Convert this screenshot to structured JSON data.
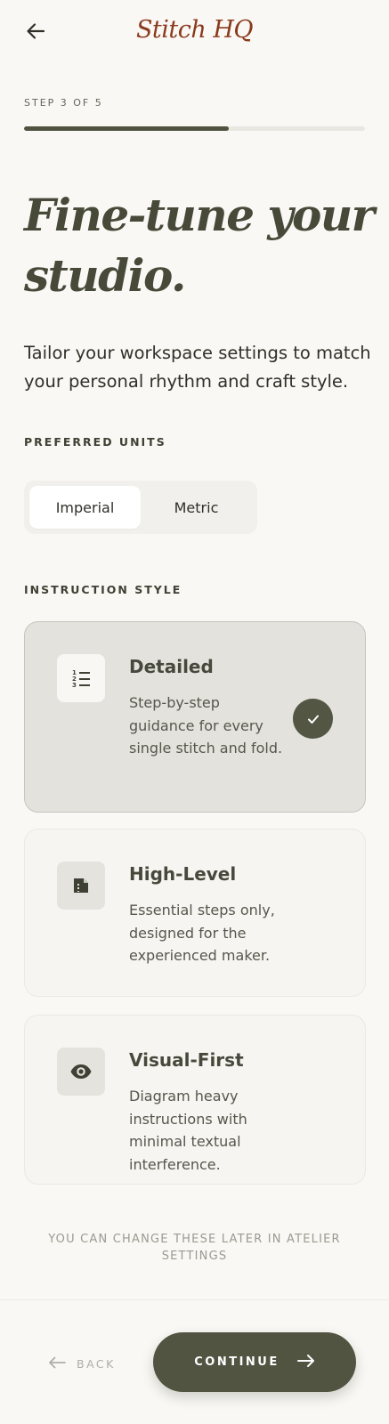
{
  "header": {
    "brand": "Stitch HQ",
    "back_icon": "arrow-left-icon"
  },
  "progress": {
    "step_label": "STEP 3 OF 5",
    "current": 3,
    "total": 5,
    "fraction": 0.6
  },
  "headline": {
    "line1": "Fine-tune your",
    "line2": "studio."
  },
  "subtitle": "Tailor your workspace settings to match your personal rhythm and craft style.",
  "units": {
    "label": "PREFERRED UNITS",
    "options": [
      "Imperial",
      "Metric"
    ],
    "selected": "Imperial"
  },
  "instruction": {
    "label": "INSTRUCTION STYLE",
    "options": [
      {
        "title": "Detailed",
        "description": "Step-by-step guidance for every single stitch and fold.",
        "icon": "numbered-list-icon",
        "selected": true
      },
      {
        "title": "High-Level",
        "description": "Essential steps only, designed for the experienced maker.",
        "icon": "summary-document-icon",
        "selected": false
      },
      {
        "title": "Visual-First",
        "description": "Diagram heavy instructions with minimal textual interference.",
        "icon": "eye-icon",
        "selected": false
      }
    ]
  },
  "footnote": "YOU CAN CHANGE THESE LATER IN ATELIER SETTINGS",
  "footer": {
    "back_label": "BACK",
    "continue_label": "CONTINUE"
  },
  "colors": {
    "accent": "#505441",
    "brand": "#8a3a1c",
    "background": "#f9f8f4"
  }
}
